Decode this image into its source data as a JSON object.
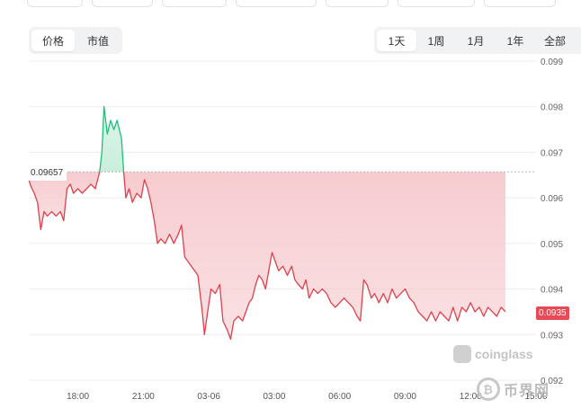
{
  "toolbar_top": [
    "",
    "",
    "",
    "",
    "",
    "",
    ""
  ],
  "metric_toggle": {
    "options": [
      "价格",
      "市值"
    ],
    "selected": "价格"
  },
  "range_tabs": {
    "options": [
      "1天",
      "1周",
      "1月",
      "1年",
      "全部"
    ],
    "selected": "1天"
  },
  "open_price_label": "0.09657",
  "last_price_label": "0.0935",
  "watermark": "coinglass",
  "corner_watermark": "币界网",
  "colors": {
    "up_line": "#1fbf7a",
    "down_line": "#e0404b",
    "down_fill": "#f6c9cd",
    "up_fill": "#c9eedc",
    "last_tag": "#e64a55"
  },
  "chart_data": {
    "type": "area",
    "baseline": 0.09657,
    "x_ticks": [
      "18:00",
      "21:00",
      "03-06",
      "03:00",
      "06:00",
      "09:00",
      "12:00",
      "15:00"
    ],
    "y_ticks": [
      "0.099",
      "0.098",
      "0.097",
      "0.096",
      "0.095",
      "0.094",
      "0.093",
      "0.092"
    ],
    "ylim": [
      0.092,
      0.099
    ],
    "x_range_hours": [
      15.75,
      39.0
    ],
    "series": [
      {
        "values": [
          [
            15.75,
            0.0964
          ],
          [
            15.85,
            0.09625
          ],
          [
            16.0,
            0.0961
          ],
          [
            16.15,
            0.0959
          ],
          [
            16.3,
            0.0953
          ],
          [
            16.45,
            0.0957
          ],
          [
            16.6,
            0.0956
          ],
          [
            16.8,
            0.0957
          ],
          [
            17.0,
            0.0956
          ],
          [
            17.2,
            0.0957
          ],
          [
            17.35,
            0.0955
          ],
          [
            17.5,
            0.0962
          ],
          [
            17.65,
            0.0963
          ],
          [
            17.8,
            0.0961
          ],
          [
            18.0,
            0.0962
          ],
          [
            18.2,
            0.0961
          ],
          [
            18.4,
            0.0962
          ],
          [
            18.6,
            0.0963
          ],
          [
            18.8,
            0.0962
          ],
          [
            19.0,
            0.09657
          ],
          [
            19.1,
            0.097
          ],
          [
            19.2,
            0.098
          ],
          [
            19.35,
            0.0974
          ],
          [
            19.5,
            0.0977
          ],
          [
            19.65,
            0.0975
          ],
          [
            19.8,
            0.0977
          ],
          [
            20.0,
            0.0973
          ],
          [
            20.1,
            0.09657
          ],
          [
            20.2,
            0.096
          ],
          [
            20.35,
            0.0962
          ],
          [
            20.5,
            0.0959
          ],
          [
            20.7,
            0.0961
          ],
          [
            20.9,
            0.096
          ],
          [
            21.05,
            0.0964
          ],
          [
            21.2,
            0.0962
          ],
          [
            21.35,
            0.0959
          ],
          [
            21.5,
            0.0955
          ],
          [
            21.65,
            0.095
          ],
          [
            21.8,
            0.0951
          ],
          [
            22.0,
            0.095
          ],
          [
            22.2,
            0.0952
          ],
          [
            22.4,
            0.095
          ],
          [
            22.6,
            0.0952
          ],
          [
            22.75,
            0.0954
          ],
          [
            22.9,
            0.0947
          ],
          [
            23.05,
            0.0946
          ],
          [
            23.2,
            0.0945
          ],
          [
            23.35,
            0.0944
          ],
          [
            23.5,
            0.0943
          ],
          [
            23.7,
            0.0935
          ],
          [
            23.8,
            0.093
          ],
          [
            23.95,
            0.0935
          ],
          [
            24.1,
            0.094
          ],
          [
            24.3,
            0.0939
          ],
          [
            24.5,
            0.0941
          ],
          [
            24.65,
            0.0933
          ],
          [
            24.85,
            0.0931
          ],
          [
            25.0,
            0.0929
          ],
          [
            25.15,
            0.0933
          ],
          [
            25.35,
            0.0934
          ],
          [
            25.55,
            0.0933
          ],
          [
            25.7,
            0.0935
          ],
          [
            25.85,
            0.0937
          ],
          [
            26.0,
            0.0938
          ],
          [
            26.15,
            0.0941
          ],
          [
            26.3,
            0.0943
          ],
          [
            26.45,
            0.0942
          ],
          [
            26.6,
            0.094
          ],
          [
            26.75,
            0.0944
          ],
          [
            26.9,
            0.0948
          ],
          [
            27.05,
            0.0946
          ],
          [
            27.2,
            0.0944
          ],
          [
            27.4,
            0.0945
          ],
          [
            27.6,
            0.0943
          ],
          [
            27.8,
            0.0945
          ],
          [
            27.95,
            0.0942
          ],
          [
            28.1,
            0.0941
          ],
          [
            28.3,
            0.094
          ],
          [
            28.45,
            0.0942
          ],
          [
            28.6,
            0.0938
          ],
          [
            28.8,
            0.094
          ],
          [
            29.0,
            0.0939
          ],
          [
            29.2,
            0.094
          ],
          [
            29.4,
            0.0939
          ],
          [
            29.6,
            0.0937
          ],
          [
            29.8,
            0.0936
          ],
          [
            30.0,
            0.0937
          ],
          [
            30.2,
            0.0938
          ],
          [
            30.4,
            0.0937
          ],
          [
            30.6,
            0.0936
          ],
          [
            30.8,
            0.0934
          ],
          [
            30.95,
            0.0933
          ],
          [
            31.1,
            0.0942
          ],
          [
            31.25,
            0.0941
          ],
          [
            31.45,
            0.0938
          ],
          [
            31.6,
            0.0939
          ],
          [
            31.8,
            0.0937
          ],
          [
            32.0,
            0.0939
          ],
          [
            32.2,
            0.0937
          ],
          [
            32.4,
            0.094
          ],
          [
            32.6,
            0.0938
          ],
          [
            32.8,
            0.0939
          ],
          [
            33.0,
            0.094
          ],
          [
            33.2,
            0.0938
          ],
          [
            33.4,
            0.0937
          ],
          [
            33.6,
            0.0935
          ],
          [
            33.8,
            0.0934
          ],
          [
            34.0,
            0.0933
          ],
          [
            34.2,
            0.0935
          ],
          [
            34.4,
            0.0933
          ],
          [
            34.6,
            0.0935
          ],
          [
            34.8,
            0.0934
          ],
          [
            35.0,
            0.0933
          ],
          [
            35.2,
            0.0936
          ],
          [
            35.4,
            0.0933
          ],
          [
            35.6,
            0.0936
          ],
          [
            35.8,
            0.0935
          ],
          [
            36.0,
            0.0937
          ],
          [
            36.2,
            0.0935
          ],
          [
            36.4,
            0.0936
          ],
          [
            36.6,
            0.0934
          ],
          [
            36.8,
            0.0936
          ],
          [
            37.0,
            0.0935
          ],
          [
            37.2,
            0.0934
          ],
          [
            37.4,
            0.0936
          ],
          [
            37.6,
            0.0935
          ]
        ]
      }
    ]
  }
}
